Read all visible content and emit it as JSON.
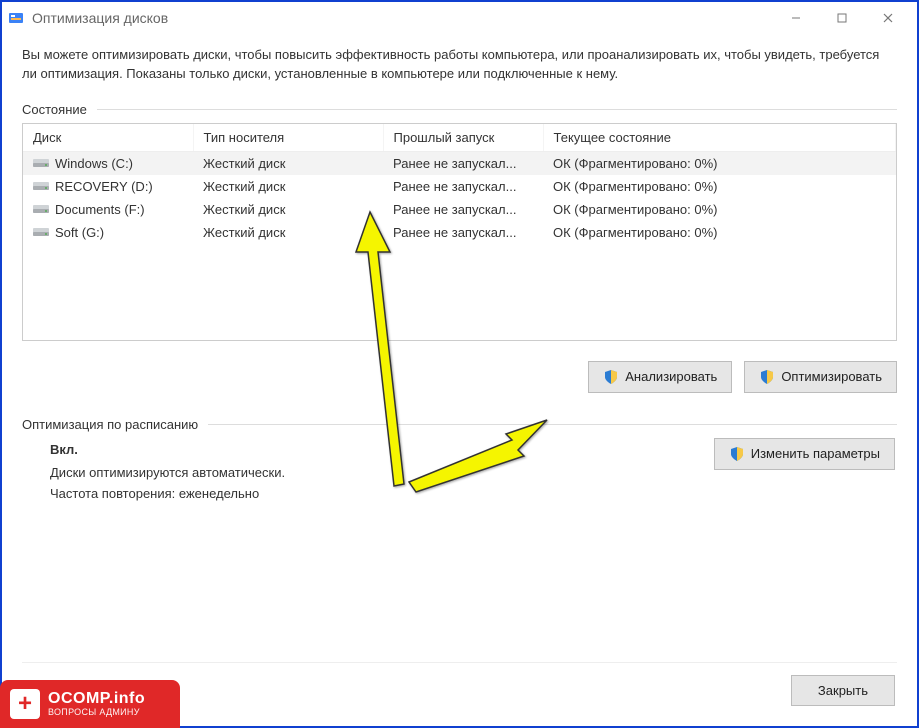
{
  "titlebar": {
    "title": "Оптимизация дисков"
  },
  "intro": "Вы можете оптимизировать диски, чтобы повысить эффективность работы  компьютера, или проанализировать их, чтобы увидеть, требуется ли оптимизация. Показаны только диски, установленные в компьютере или подключенные к нему.",
  "state_label": "Состояние",
  "columns": {
    "disk": "Диск",
    "media": "Тип носителя",
    "last_run": "Прошлый запуск",
    "status": "Текущее состояние"
  },
  "rows": [
    {
      "disk": "Windows (C:)",
      "media": "Жесткий диск",
      "last_run": "Ранее не запускал...",
      "status": "ОК (Фрагментировано: 0%)",
      "selected": true
    },
    {
      "disk": "RECOVERY (D:)",
      "media": "Жесткий диск",
      "last_run": "Ранее не запускал...",
      "status": "ОК (Фрагментировано: 0%)",
      "selected": false
    },
    {
      "disk": "Documents (F:)",
      "media": "Жесткий диск",
      "last_run": "Ранее не запускал...",
      "status": "ОК (Фрагментировано: 0%)",
      "selected": false
    },
    {
      "disk": "Soft (G:)",
      "media": "Жесткий диск",
      "last_run": "Ранее не запускал...",
      "status": "ОК (Фрагментировано: 0%)",
      "selected": false
    }
  ],
  "buttons": {
    "analyze": "Анализировать",
    "optimize": "Оптимизировать",
    "change_settings": "Изменить параметры",
    "close": "Закрыть"
  },
  "schedule": {
    "section_label": "Оптимизация по расписанию",
    "on": "Вкл.",
    "auto": "Диски оптимизируются автоматически.",
    "freq": "Частота повторения: еженедельно"
  },
  "logo": {
    "big": "OCOMP.info",
    "small": "ВОПРОСЫ АДМИНУ"
  }
}
